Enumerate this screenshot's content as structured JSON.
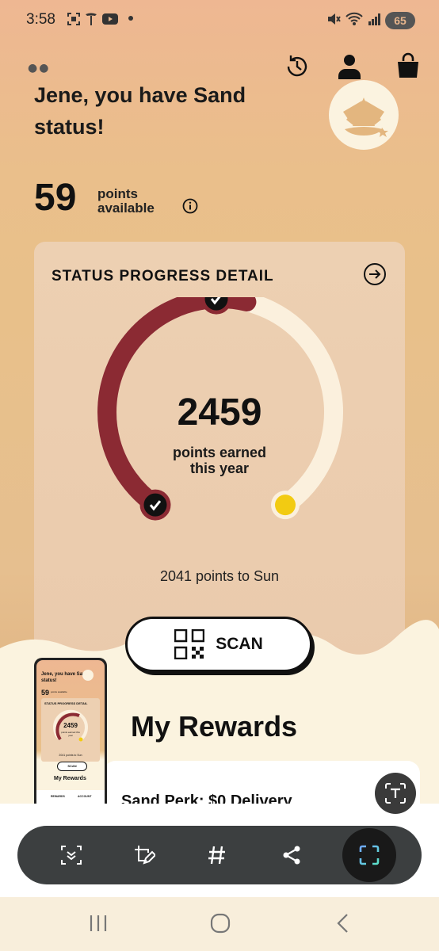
{
  "status_bar": {
    "time": "3:58",
    "battery": "65"
  },
  "header": {
    "greeting": "Jene, you have Sand status!",
    "points_available": "59",
    "points_label_line1": "points",
    "points_label_line2": "available"
  },
  "status_card": {
    "title": "STATUS PROGRESS DETAIL",
    "points_earned": "2459",
    "earned_label_line1": "points earned",
    "earned_label_line2": "this year",
    "to_next_tier": "2041 points to Sun",
    "progress_fraction": 0.5466
  },
  "scan_button": {
    "label": "SCAN"
  },
  "rewards": {
    "title": "My Rewards",
    "first_item": "Sand Perk: $0 Delivery"
  },
  "thumbnail": {
    "greeting": "Jene, you have Sand status!",
    "points": "59",
    "points_label": "points available",
    "card_title": "STATUS PROGRESS DETAIL",
    "earned": "2459",
    "earned_label": "points earned this year",
    "to_next": "2041 points to Sun",
    "scan": "SCAN",
    "rewards_title": "My Rewards",
    "tab_rewards": "REWARDS",
    "tab_account": "ACCOUNT"
  },
  "colors": {
    "progress": "#8b2a33",
    "track": "#fbf0dd",
    "goal_dot": "#f2cb12",
    "cream": "#fbf3df"
  },
  "icons": {
    "history": "history-clock-icon",
    "profile": "person-icon",
    "bag": "shopping-bag-icon",
    "info": "info-icon",
    "arrow": "circle-arrow-right-icon",
    "qr": "qr-code-icon",
    "text": "text-extract-icon"
  }
}
